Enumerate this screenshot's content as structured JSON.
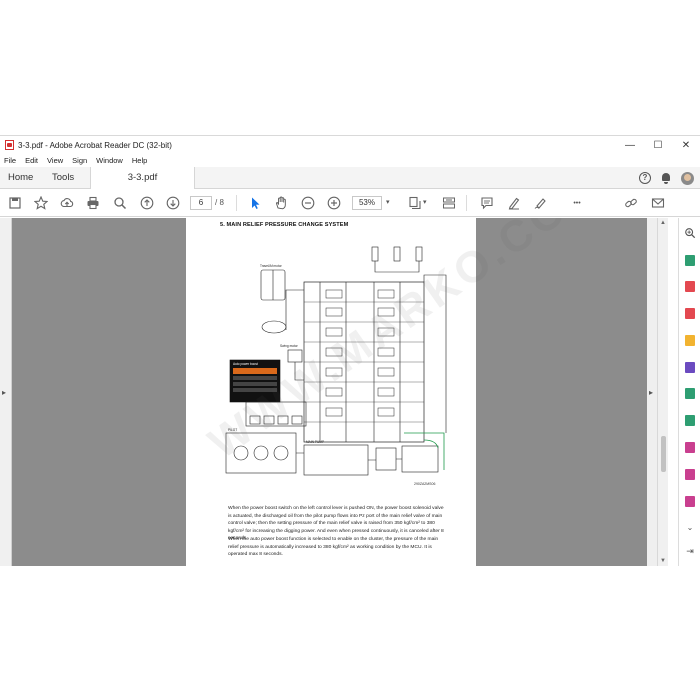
{
  "window": {
    "title": "3-3.pdf - Adobe Acrobat Reader DC (32-bit)",
    "controls": {
      "minimize": "—",
      "maximize": "☐",
      "close": "✕"
    }
  },
  "menu": [
    "File",
    "Edit",
    "View",
    "Sign",
    "Window",
    "Help"
  ],
  "tabs": {
    "home": "Home",
    "tools": "Tools",
    "document": "3-3.pdf"
  },
  "toolbar": {
    "page_current": "6",
    "page_total": "/ 8",
    "zoom": "53%",
    "zoom_caret": "▾",
    "tool_caret": "▾",
    "more": "•••"
  },
  "collapse": {
    "left": "◂",
    "right": "▸"
  },
  "scroll": {
    "up": "▲",
    "down": "▼"
  },
  "doc": {
    "heading": "5. MAIN RELIEF PRESSURE CHANGE SYSTEM",
    "figure_code": "290ZA2MS06",
    "paragraph1": "When the power boost switch on the left control lever is pushed ON, the power boost solenoid valve is actuated, the discharged oil from the pilot pump flows into Pz port of the main relief valve of main control valve; then the setting pressure of the main relief valve is raised from 350 kgf/cm² to 380 kgf/cm² for increasing the digging power.",
    "paragraph1b": "And even when pressed continuously, it is canceled after 8 seconds.",
    "paragraph2": "When the auto power boost function is selected to enable on the cluster, the pressure of the main relief pressure is automatically increased to 380 kgf/cm² as working condition by the MCU. It is operated max 8 seconds.",
    "inset_title": "Auto power boost",
    "labels": {
      "travel_motor": "Travel/Af motor",
      "swing_motor": "Swing motor",
      "pilot_pump": "PILOT",
      "main_pump": "MAIN PUMP"
    },
    "watermark": "WWW.MARKO.COM"
  },
  "colors": {
    "accent_blue": "#1473e6",
    "app_red": "#d32f2f",
    "page_bg": "#8c8c8c"
  },
  "rail_icons": [
    {
      "name": "zoom-in-icon",
      "color": "#555555"
    },
    {
      "name": "export-pdf-icon",
      "color": "#2e9e72"
    },
    {
      "name": "create-pdf-icon",
      "color": "#e34850"
    },
    {
      "name": "edit-pdf-icon",
      "color": "#e34850"
    },
    {
      "name": "comment-icon",
      "color": "#f2b330"
    },
    {
      "name": "combine-files-icon",
      "color": "#6b4bc0"
    },
    {
      "name": "organize-pages-icon",
      "color": "#2e9e72"
    },
    {
      "name": "compress-pdf-icon",
      "color": "#2e9e72"
    },
    {
      "name": "fill-sign-icon",
      "color": "#c93f8f"
    },
    {
      "name": "send-for-signature-icon",
      "color": "#c93f8f"
    },
    {
      "name": "protect-icon",
      "color": "#c93f8f"
    },
    {
      "name": "more-tools-icon",
      "color": "#555555"
    },
    {
      "name": "collapse-rail-icon",
      "color": "#555555"
    }
  ]
}
